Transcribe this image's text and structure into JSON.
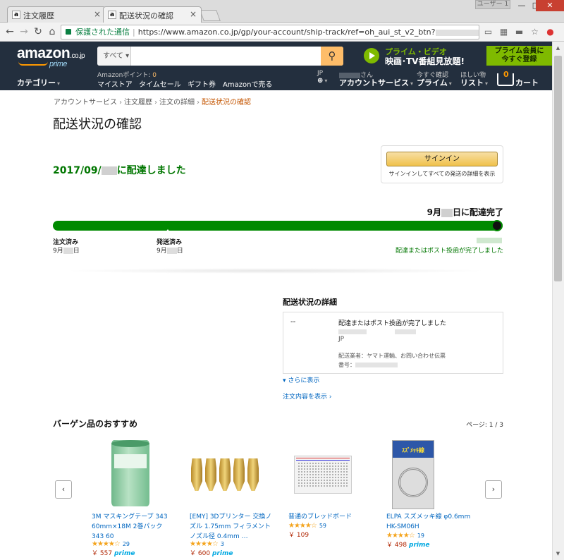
{
  "browser": {
    "tabs": [
      {
        "label": "注文履歴",
        "favicon": "a"
      },
      {
        "label": "配送状況の確認",
        "favicon": "a"
      }
    ],
    "user_badge": "ユーザー 1",
    "window_controls": {
      "minimize": "—",
      "maximize": "□",
      "close": "✕"
    },
    "address": {
      "secure_label": "保護された通信",
      "url": "https://www.amazon.co.jp/gp/your-account/ship-track/ref=oh_aui_st_v2_btn?"
    },
    "icons": [
      "back-icon",
      "forward-icon",
      "reload-icon",
      "home-icon",
      "cast-icon",
      "star-icon"
    ]
  },
  "header": {
    "logo": "amazon",
    "logo_suffix": ".co.jp",
    "logo_prime": "prime",
    "search_category": "すべて",
    "search_placeholder": "",
    "prime_video": {
      "line1": "プライム・ビデオ",
      "line2": "映画･TV番組見放題!",
      "cta_line1": "プライム会員に",
      "cta_line2": "今すぐ登録"
    },
    "points_label": "Amazonポイント:",
    "points_value": "0",
    "nav": [
      "マイストア",
      "タイムセール",
      "ギフト券",
      "Amazonで売る"
    ],
    "category_menu": "カテゴリー",
    "lang": "JP",
    "account_greeting": "さん",
    "account_services": "アカウントサービス",
    "prime_label": "今すぐ確認",
    "prime_link": "プライム",
    "wishlist_label": "ほしい物",
    "wishlist_link": "リスト",
    "cart_count": "0",
    "cart_label": "カート"
  },
  "breadcrumb": [
    "アカウントサービス",
    "注文履歴",
    "注文の詳細",
    "配送状況の確認"
  ],
  "page_title": "配送状況の確認",
  "delivery_status": {
    "prefix": "2017/09/",
    "suffix": "に配達しました"
  },
  "signin": {
    "button": "サインイン",
    "note": "サインインしてすべての発送の詳細を表示"
  },
  "tracker": {
    "eta_prefix": "9月",
    "eta_suffix": "日に配達完了",
    "progress": 1.0,
    "steps": [
      {
        "label": "注文済み",
        "date_prefix": "9月",
        "date_suffix": "日"
      },
      {
        "label": "発送済み",
        "date_prefix": "9月",
        "date_suffix": "日"
      }
    ],
    "final_note": "配達またはポスト投函が完了しました"
  },
  "details": {
    "title": "配送状況の詳細",
    "time": "--",
    "event": "配達またはポスト投函が完了しました",
    "country": "JP",
    "carrier": "配送業者：ヤマト運輸、お問い合わせ伝票",
    "number_label": "番号：",
    "more": "さらに表示",
    "order_link": "注文内容を表示 ›"
  },
  "recommendations": {
    "title": "バーゲン品のおすすめ",
    "page_indicator": "ページ: 1 / 3",
    "prev": "‹",
    "next": "›",
    "products": [
      {
        "title": "3M マスキングテープ 343 60mm×18M 2巻パック 343 60",
        "stars": "★★★★☆",
        "reviews": "29",
        "price": "￥ 557",
        "prime": "prime"
      },
      {
        "title": "[EMY] 3Dプリンター 交換ノズル 1.75mm フィラメント ノズル径 0.4mm …",
        "stars": "★★★★☆",
        "reviews": "3",
        "price": "￥ 600",
        "prime": "prime"
      },
      {
        "title": "普通のブレッドボード",
        "stars": "★★★★☆",
        "reviews": "59",
        "price": "￥ 109",
        "prime": ""
      },
      {
        "title": "ELPA スズメッキ線 φ0.6mm HK-SM06H",
        "stars": "★★★★☆",
        "reviews": "19",
        "price": "￥ 498",
        "prime": "prime"
      }
    ]
  },
  "colors": {
    "header_bg": "#232f3e",
    "accent_orange": "#febd69",
    "status_green": "#007600",
    "track_green": "#008a00",
    "link_blue": "#0066c0"
  }
}
